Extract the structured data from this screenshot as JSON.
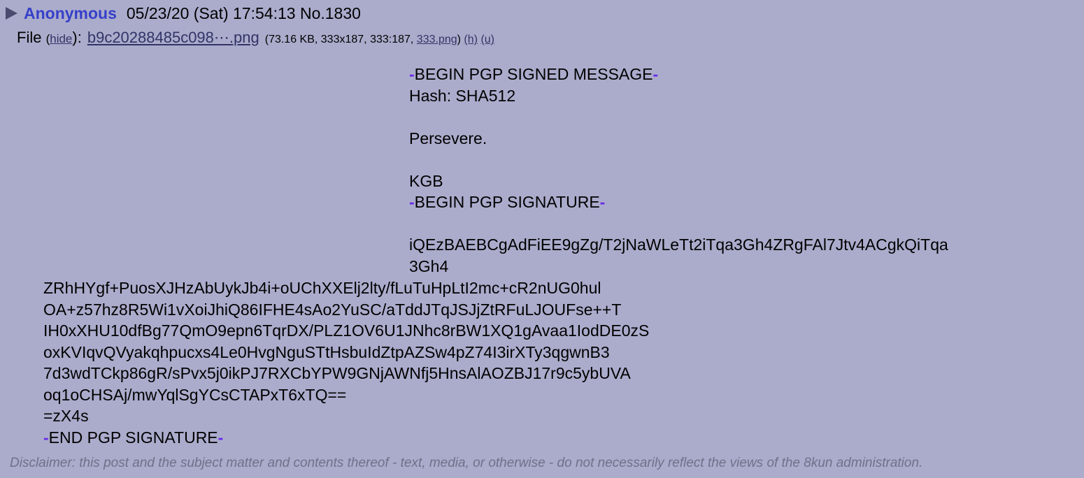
{
  "header": {
    "toggle_icon": "expand-triangle-icon",
    "name": "Anonymous",
    "datetime": "05/23/20 (Sat) 17:54:13",
    "post_no": "No.1830"
  },
  "file": {
    "label": "File",
    "open_paren": "(",
    "hide_link": "hide",
    "close_paren_colon": "):",
    "filename": "b9c20288485c098⋯.png",
    "info_prefix": "(73.16 KB, 333x187, 333:187,",
    "original_name": "333.png",
    "info_suffix": ")",
    "h_link": "(h)",
    "u_link": "(u)"
  },
  "message": {
    "dash": "-",
    "begin_signed": "BEGIN PGP SIGNED MESSAGE",
    "hash": "Hash: SHA512",
    "body": "Persevere.",
    "signoff": "KGB",
    "begin_signature": "BEGIN PGP SIGNATURE",
    "sig_line_1": "iQEzBAEBCgAdFiEE9gZg/T2jNaWLeTt2iTqa3Gh4ZRgFAl7Jtv4ACgkQiTqa",
    "sig_line_2": "3Gh4",
    "sig_line_3": "ZRhHYgf+PuosXJHzAbUykJb4i+oUChXXElj2lty/fLuTuHpLtI2mc+cR2nUG0hul",
    "sig_line_4": "OA+z57hz8R5Wi1vXoiJhiQ86IFHE4sAo2YuSC/aTddJTqJSJjZtRFuLJOUFse++T",
    "sig_line_5": "IH0xXHU10dfBg77QmO9epn6TqrDX/PLZ1OV6U1JNhc8rBW1XQ1gAvaa1IodDE0zS",
    "sig_line_6": "oxKVIqvQVyakqhpucxs4Le0HvgNguSTtHsbuIdZtpAZSw4pZ74I3irXTy3qgwnB3",
    "sig_line_7": "7d3wdTCkp86gR/sPvx5j0ikPJ7RXCbYPW9GNjAWNfj5HnsAlAOZBJ17r9c5ybUVA",
    "sig_line_8": "oq1oCHSAj/mwYqlSgYCsCTAPxT6xTQ==",
    "checksum": "=zX4s",
    "end_signature": "END PGP SIGNATURE"
  },
  "disclaimer": "Disclaimer: this post and the subject matter and contents thereof - text, media, or otherwise - do not necessarily reflect the views of the 8kun administration.",
  "colors": {
    "background": "#abaccc",
    "name": "#3640c8",
    "link": "#333366",
    "dash": "#6a2be8",
    "disclaimer": "#707088"
  }
}
